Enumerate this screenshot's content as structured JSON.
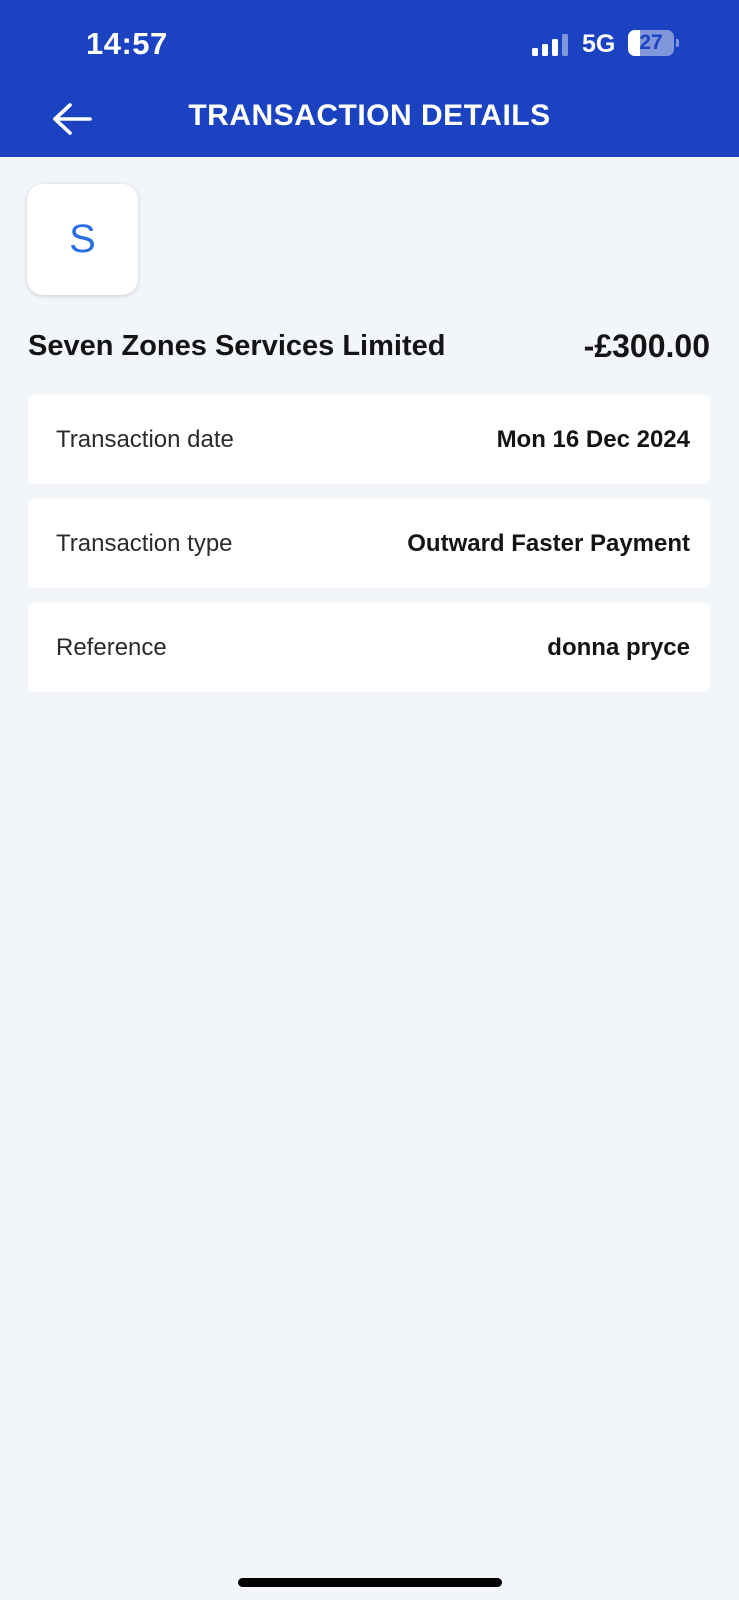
{
  "status_bar": {
    "time": "14:57",
    "network": "5G",
    "battery": "27",
    "battery_level": 0.27,
    "signal_bars_active": 3,
    "signal_bars_total": 4
  },
  "header": {
    "title": "TRANSACTION DETAILS",
    "back_icon": "arrow-left-icon",
    "color": "#1b42c0"
  },
  "transaction": {
    "avatar_initial": "S",
    "payee": "Seven Zones Services Limited",
    "amount": "-£300.00",
    "details": [
      {
        "label": "Transaction date",
        "value": "Mon 16 Dec 2024"
      },
      {
        "label": "Transaction type",
        "value": "Outward Faster Payment"
      },
      {
        "label": "Reference",
        "value": "donna pryce"
      }
    ]
  }
}
